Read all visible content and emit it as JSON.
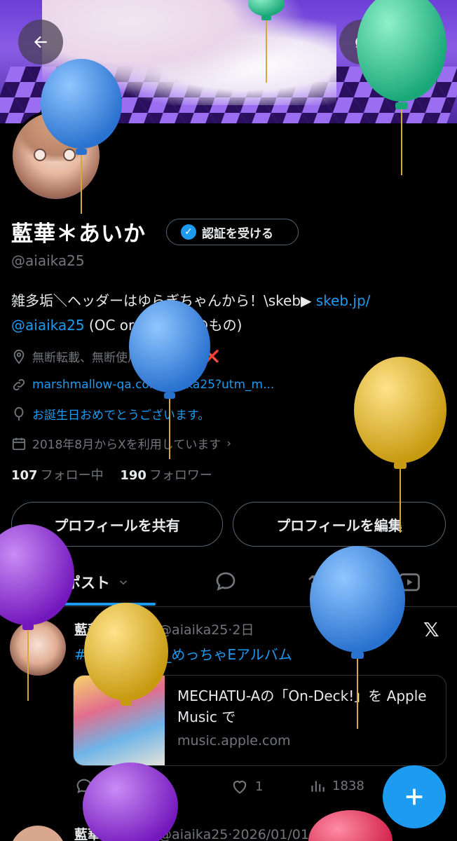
{
  "profile": {
    "display_name": "藍華＊あいか",
    "verify_label": "認証を受ける",
    "handle": "@aiaika25",
    "bio_text": "雑多垢＼ヘッダーはゆらぎちゃんから！\\skeb▶ ",
    "bio_link": "skeb.jp/",
    "bio_link2": "@aiaika25",
    "bio_suffix": " (OC or 許可済みのもの)",
    "location": "無断転載、無断使用、自作発言",
    "location_mark": "❌",
    "website": "marshmallow-qa.com/aiaika25?utm_m...",
    "birthday": "お誕生日おめでとうございます。",
    "joined": "2018年8月からXを利用しています",
    "following_count": "107",
    "following_label": "フォロー中",
    "followers_count": "190",
    "followers_label": "フォロワー"
  },
  "buttons": {
    "share": "プロフィールを共有",
    "edit": "プロフィールを編集"
  },
  "tabs": {
    "posts": "ポスト"
  },
  "post": {
    "author": "藍華＊あいか",
    "handle_time": " @aiaika25·2日",
    "hashtag": "#MECHATUA_めっちゃEアルバム",
    "card_title": "MECHATU-Aの「On-Deck!」を Apple Music で",
    "card_domain": "music.apple.com",
    "likes": "1",
    "views": "1838"
  },
  "post2": {
    "author": "藍華＊あいか",
    "handle_time": " @aiaika25·2026/01/01"
  },
  "colors": {
    "accent": "#1d9bf0",
    "background": "#000000",
    "muted": "#71767b",
    "balloon_blue": "#3d8fe6",
    "balloon_green": "#2fc79a",
    "balloon_yellow": "#e0b21c",
    "balloon_purple": "#8e2fd0",
    "balloon_red": "#e8325a"
  }
}
